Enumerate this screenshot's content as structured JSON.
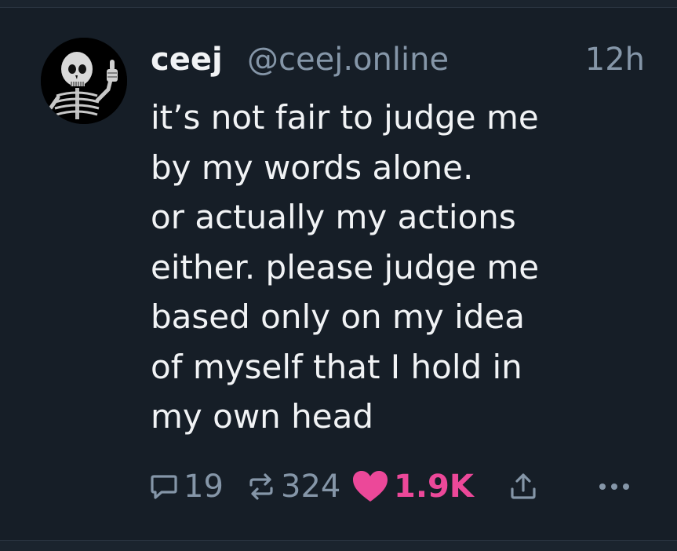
{
  "post": {
    "author": {
      "display_name": "ceej",
      "handle": "@ceej.online",
      "avatar_icon": "skeleton-thumbs-up-avatar"
    },
    "timestamp": "12h",
    "text_lines": [
      "it’s not fair to judge me",
      "by my words alone.",
      "or actually my actions",
      "either. please judge me",
      "based only on my idea",
      "of myself that I hold in",
      "my own head"
    ],
    "actions": {
      "replies": {
        "icon": "reply-icon",
        "count": "19"
      },
      "reposts": {
        "icon": "repost-icon",
        "count": "324"
      },
      "likes": {
        "icon": "heart-icon",
        "count": "1.9K",
        "liked": true
      },
      "share": {
        "icon": "share-icon"
      },
      "more": {
        "icon": "more-icon"
      }
    }
  },
  "colors": {
    "background": "#161e27",
    "text": "#f1f3f5",
    "muted": "#8596a8",
    "like": "#ec4899"
  }
}
